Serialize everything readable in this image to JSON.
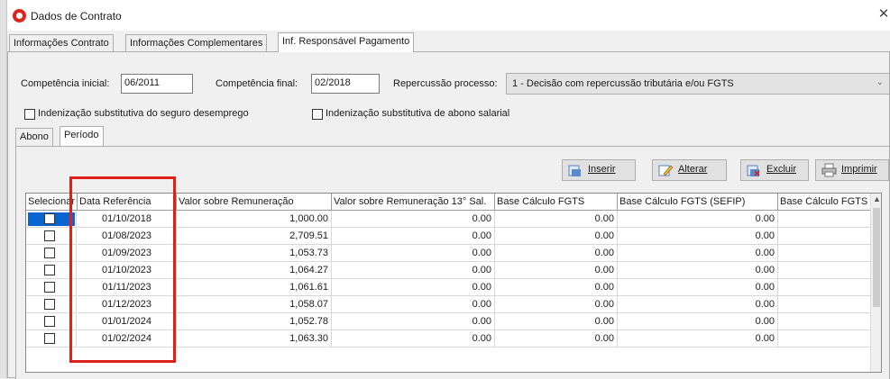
{
  "window": {
    "title": "Dados de Contrato",
    "close_glyph": "✕"
  },
  "tabs": [
    {
      "label": "Informações Contrato"
    },
    {
      "label": "Informações Complementares"
    },
    {
      "label": "Inf. Responsável Pagamento"
    }
  ],
  "form": {
    "competencia_inicial_label": "Competência inicial:",
    "competencia_inicial_value": "06/2011",
    "competencia_final_label": "Competência final:",
    "competencia_final_value": "02/2018",
    "repercussao_label": "Repercussão processo:",
    "repercussao_value": "1 - Decisão com repercussão tributária e/ou FGTS",
    "indenizacao_desemprego_label": "Indenização substitutiva do seguro desemprego",
    "indenizacao_abono_label": "Indenização substitutiva de abono salarial"
  },
  "inner_tabs": [
    {
      "label": "Abono"
    },
    {
      "label": "Período"
    }
  ],
  "toolbar": {
    "inserir": "Inserir",
    "alterar": "Alterar",
    "excluir": "Excluir",
    "imprimir": "Imprimir"
  },
  "grid": {
    "columns": [
      "Selecionar",
      "Data Referência",
      "Valor sobre Remuneração",
      "Valor sobre Remuneração 13° Sal.",
      "Base Cálculo FGTS",
      "Base Cálculo FGTS (SEFIP)",
      "Base Cálculo FGTS (SEFIP)"
    ],
    "rows": [
      {
        "data": "01/10/2018",
        "valor": "1,000.00",
        "valor13": "0.00",
        "fgts": "0.00",
        "sefip": "0.00"
      },
      {
        "data": "01/08/2023",
        "valor": "2,709.51",
        "valor13": "0.00",
        "fgts": "0.00",
        "sefip": "0.00"
      },
      {
        "data": "01/09/2023",
        "valor": "1,053.73",
        "valor13": "0.00",
        "fgts": "0.00",
        "sefip": "0.00"
      },
      {
        "data": "01/10/2023",
        "valor": "1,064.27",
        "valor13": "0.00",
        "fgts": "0.00",
        "sefip": "0.00"
      },
      {
        "data": "01/11/2023",
        "valor": "1,061.61",
        "valor13": "0.00",
        "fgts": "0.00",
        "sefip": "0.00"
      },
      {
        "data": "01/12/2023",
        "valor": "1,058.07",
        "valor13": "0.00",
        "fgts": "0.00",
        "sefip": "0.00"
      },
      {
        "data": "01/01/2024",
        "valor": "1,052.78",
        "valor13": "0.00",
        "fgts": "0.00",
        "sefip": "0.00"
      },
      {
        "data": "01/02/2024",
        "valor": "1,063.30",
        "valor13": "0.00",
        "fgts": "0.00",
        "sefip": "0.00"
      }
    ]
  },
  "colors": {
    "highlight": "#e0201b",
    "selection": "#0a64d0",
    "app_icon": "#d8261c"
  }
}
